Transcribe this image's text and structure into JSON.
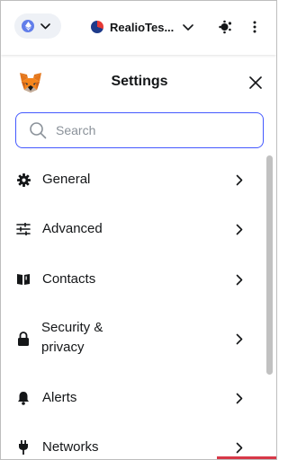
{
  "topbar": {
    "network_icon": "ethereum-icon",
    "account_name": "RealioTes...",
    "colors": {
      "network_bg": "#eef1f6",
      "eth_blue": "#627eea"
    }
  },
  "settings": {
    "title": "Settings",
    "search": {
      "placeholder": "Search",
      "value": ""
    },
    "items": [
      {
        "label": "General",
        "icon": "gear-icon"
      },
      {
        "label": "Advanced",
        "icon": "sliders-icon"
      },
      {
        "label": "Contacts",
        "icon": "book-icon"
      },
      {
        "label_line1": "Security &",
        "label_line2": "privacy",
        "icon": "lock-icon"
      },
      {
        "label": "Alerts",
        "icon": "bell-icon"
      },
      {
        "label": "Networks",
        "icon": "plug-icon"
      }
    ]
  },
  "colors": {
    "accent": "#4459ff",
    "text": "#141618",
    "muted": "#8a9199"
  }
}
